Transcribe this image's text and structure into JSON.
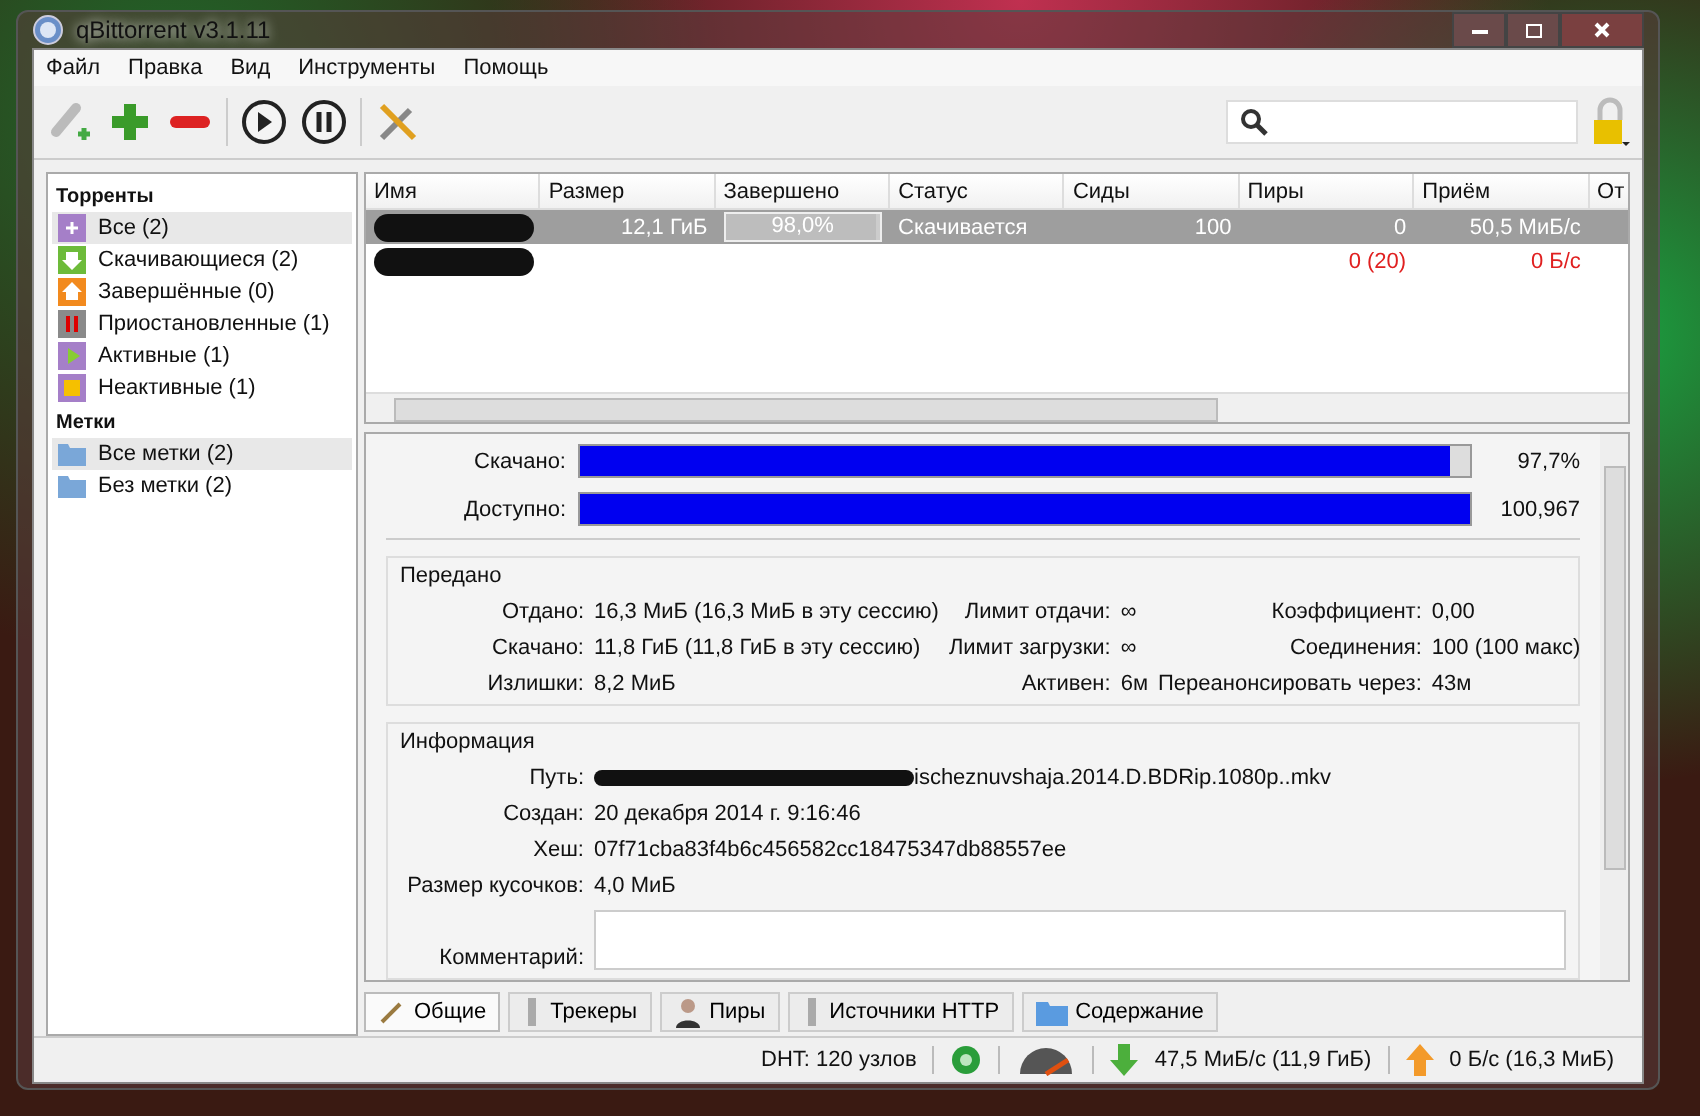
{
  "window": {
    "title": "qBittorrent v3.1.11"
  },
  "menu": [
    "Файл",
    "Правка",
    "Вид",
    "Инструменты",
    "Помощь"
  ],
  "toolbar": [
    {
      "kind": "add-link"
    },
    {
      "kind": "add"
    },
    {
      "kind": "remove"
    },
    {
      "kind": "sep"
    },
    {
      "kind": "resume"
    },
    {
      "kind": "pause"
    },
    {
      "kind": "sep"
    },
    {
      "kind": "options"
    }
  ],
  "sidebar": {
    "sections": [
      {
        "title": "Торренты",
        "items": [
          {
            "label": "Все (2)",
            "selected": true,
            "color": "#a57fc8",
            "kind": "all"
          },
          {
            "label": "Скачивающиеся (2)",
            "selected": false,
            "color": "#6dbb3a",
            "kind": "down"
          },
          {
            "label": "Завершённые (0)",
            "selected": false,
            "color": "#f28a1e",
            "kind": "up"
          },
          {
            "label": "Приостановленные (1)",
            "selected": false,
            "color": "#8a8a8a",
            "kind": "pause"
          },
          {
            "label": "Активные (1)",
            "selected": false,
            "color": "#a57fc8",
            "kind": "play"
          },
          {
            "label": "Неактивные (1)",
            "selected": false,
            "color": "#a57fc8",
            "kind": "stop"
          }
        ]
      },
      {
        "title": "Метки",
        "items": [
          {
            "label": "Все метки (2)",
            "selected": true,
            "color": "#7aa7d8",
            "kind": "folder"
          },
          {
            "label": "Без метки (2)",
            "selected": false,
            "color": "#7aa7d8",
            "kind": "folder"
          }
        ]
      }
    ]
  },
  "table": {
    "columns": [
      "Имя",
      "Размер",
      "Завершено",
      "Статус",
      "Сиды",
      "Пиры",
      "Приём",
      "От"
    ],
    "rows": [
      {
        "selected": true,
        "redacted": true,
        "size": "12,1 ГиБ",
        "done": "98,0%",
        "level": 0.98,
        "status": "Скачивается",
        "seeds": "100",
        "peers": "0",
        "rx": "50,5 МиБ/с",
        "error": false
      },
      {
        "selected": false,
        "redacted": true,
        "size": "",
        "done": "",
        "status": "",
        "seeds": "",
        "peers": "0 (20)",
        "rx": "0 Б/с",
        "error": true
      }
    ]
  },
  "details": {
    "bars": [
      {
        "label": "Скачано:",
        "value": "97,7%",
        "level": 0.977
      },
      {
        "label": "Доступно:",
        "value": "100,967",
        "level": 1
      }
    ],
    "transfer": {
      "title": "Передано",
      "cells": [
        [
          "Отдано:",
          "16,3 МиБ (16,3 МиБ в эту сессию)",
          "Лимит отдачи:",
          "∞",
          "Коэффициент:",
          "0,00"
        ],
        [
          "Скачано:",
          "11,8 ГиБ (11,8 ГиБ в эту сессию)",
          "Лимит загрузки:",
          "∞",
          "Соединения:",
          "100 (100 макс)"
        ],
        [
          "Излишки:",
          "8,2 МиБ",
          "Активен:",
          "6м",
          "Переанонсировать через:",
          "43м"
        ]
      ]
    },
    "info": {
      "title": "Информация",
      "rows": [
        {
          "label": "Путь:",
          "value": "ischeznuvshaja.2014.D.BDRip.1080p..mkv",
          "redacted": true
        },
        {
          "label": "Создан:",
          "value": "20 декабря 2014 г. 9:16:46",
          "redacted": false
        },
        {
          "label": "Хеш:",
          "value": "07f71cba83f4b6c456582cc18475347db88557ee",
          "redacted": false
        },
        {
          "label": "Размер кусочков:",
          "value": "4,0 МиБ",
          "redacted": false
        }
      ],
      "comment_label": "Комментарий:"
    }
  },
  "tabs": [
    {
      "label": "Общие",
      "selected": true,
      "kind": "general"
    },
    {
      "label": "Трекеры",
      "selected": false,
      "kind": "trackers"
    },
    {
      "label": "Пиры",
      "selected": false,
      "kind": "peers"
    },
    {
      "label": "Источники HTTP",
      "selected": false,
      "kind": "http"
    },
    {
      "label": "Содержание",
      "selected": false,
      "kind": "content"
    }
  ],
  "status_bar": {
    "dht": "DHT: 120 узлов",
    "download": "47,5 МиБ/с (11,9 ГиБ)",
    "upload": "0 Б/с (16,3 МиБ)"
  }
}
